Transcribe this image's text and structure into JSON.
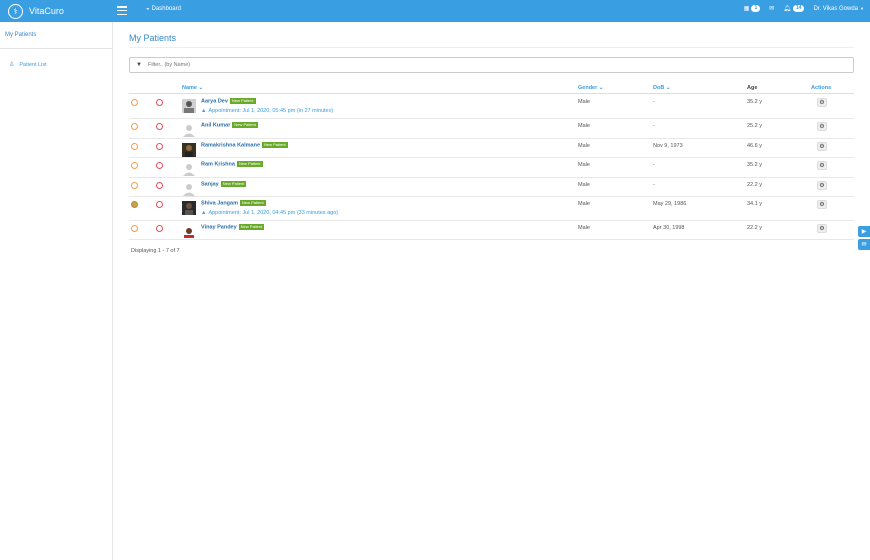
{
  "app": {
    "name": "VitaCuro"
  },
  "topbar": {
    "dashboard_label": "Dashboard",
    "calendar_count": "1",
    "notifications_count": "14",
    "user_label": "Dr. Vikas Gowda"
  },
  "sidebar": {
    "heading": "My Patients",
    "items": [
      {
        "label": "Patient List"
      }
    ]
  },
  "main": {
    "title": "My Patients",
    "filter_placeholder": "Filter.. (by Name)",
    "columns": {
      "name": "Name",
      "gender": "Gender",
      "dob": "DoB",
      "age": "Age",
      "actions": "Actions"
    },
    "new_badge": "New Patient",
    "rows": [
      {
        "name": "Aarya Dev",
        "gender": "Male",
        "dob": "-",
        "age": "35.2 y",
        "appointment": "Appointment: Jul 1, 2020, 05:45 pm (in 27 minutes)"
      },
      {
        "name": "Anil Kumar",
        "gender": "Male",
        "dob": "-",
        "age": "25.2 y"
      },
      {
        "name": "Ramakrishna Kalmane",
        "gender": "Male",
        "dob": "Nov 9, 1973",
        "age": "46.6 y"
      },
      {
        "name": "Ram Krishna",
        "gender": "Male",
        "dob": "-",
        "age": "35.2 y"
      },
      {
        "name": "Sanjay",
        "gender": "Male",
        "dob": "-",
        "age": "22.2 y"
      },
      {
        "name": "Shiva Jangam",
        "gender": "Male",
        "dob": "May 29, 1986",
        "age": "34.1 y",
        "appointment": "Appointment: Jul 1, 2020, 04:45 pm (33 minutes ago)"
      },
      {
        "name": "Vinay Pandey",
        "gender": "Male",
        "dob": "Apr 30, 1998",
        "age": "22.2 y"
      }
    ],
    "displaying": "Displaying 1 - 7 of 7"
  }
}
